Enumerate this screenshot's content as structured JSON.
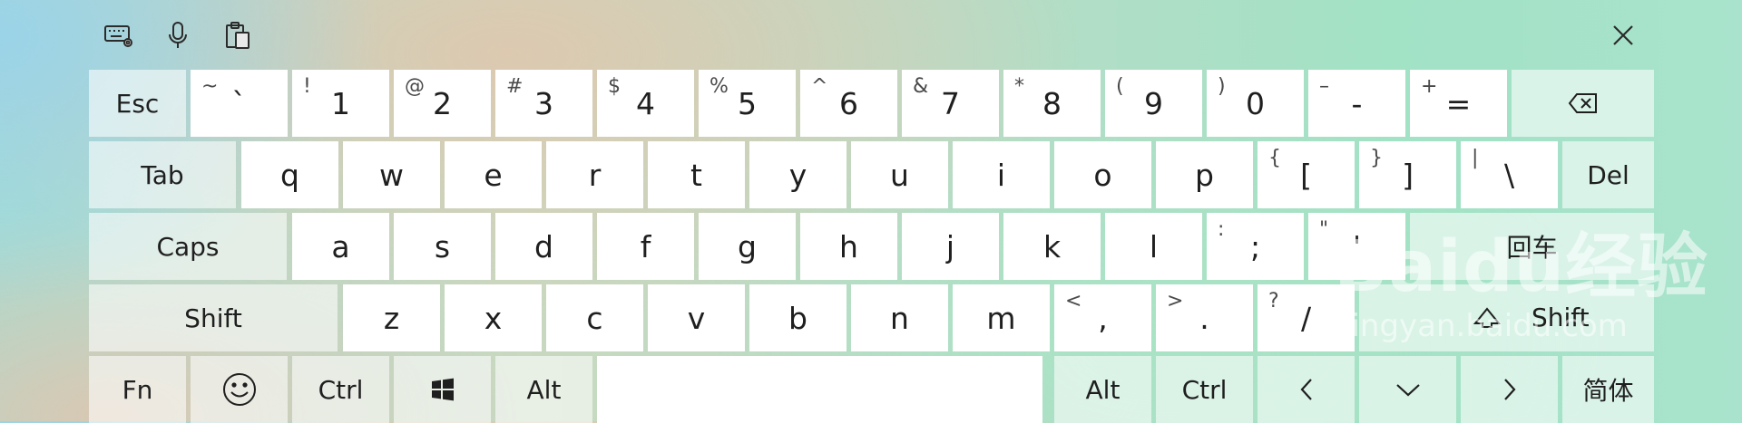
{
  "toolbar": {
    "icons": [
      "keyboard-settings-icon",
      "microphone-icon",
      "clipboard-icon",
      "close-icon"
    ]
  },
  "rows": {
    "r1": {
      "esc": "Esc",
      "k1": {
        "main": "`",
        "sec": "~"
      },
      "k2": {
        "main": "1",
        "sec": "!"
      },
      "k3": {
        "main": "2",
        "sec": "@"
      },
      "k4": {
        "main": "3",
        "sec": "#"
      },
      "k5": {
        "main": "4",
        "sec": "$"
      },
      "k6": {
        "main": "5",
        "sec": "%"
      },
      "k7": {
        "main": "6",
        "sec": "^"
      },
      "k8": {
        "main": "7",
        "sec": "&"
      },
      "k9": {
        "main": "8",
        "sec": "*"
      },
      "k10": {
        "main": "9",
        "sec": "("
      },
      "k11": {
        "main": "0",
        "sec": ")"
      },
      "k12": {
        "main": "-",
        "sec": "–"
      },
      "k13": {
        "main": "=",
        "sec": "+"
      },
      "backspace": "backspace-icon"
    },
    "r2": {
      "tab": "Tab",
      "letters": [
        "q",
        "w",
        "e",
        "r",
        "t",
        "y",
        "u",
        "i",
        "o",
        "p"
      ],
      "lbracket": {
        "main": "[",
        "sec": "{"
      },
      "rbracket": {
        "main": "]",
        "sec": "}"
      },
      "backslash": {
        "main": "\\",
        "sec": "|"
      },
      "del": "Del"
    },
    "r3": {
      "caps": "Caps",
      "letters": [
        "a",
        "s",
        "d",
        "f",
        "g",
        "h",
        "j",
        "k",
        "l"
      ],
      "semicolon": {
        "main": ";",
        "sec": ":"
      },
      "quote": {
        "main": "'",
        "sec": "\""
      },
      "enter": "回车"
    },
    "r4": {
      "shift_left": "Shift",
      "letters": [
        "z",
        "x",
        "c",
        "v",
        "b",
        "n",
        "m"
      ],
      "comma": {
        "main": ",",
        "sec": "<"
      },
      "period": {
        "main": ".",
        "sec": ">"
      },
      "slash": {
        "main": "/",
        "sec": "?"
      },
      "shift_right": "Shift"
    },
    "r5": {
      "fn": "Fn",
      "ctrl_left": "Ctrl",
      "alt_left": "Alt",
      "alt_right": "Alt",
      "ctrl_right": "Ctrl",
      "lang": "简体"
    }
  },
  "watermark": {
    "line1": "Baidu经验",
    "line2": "jingyan.baidu.com"
  }
}
